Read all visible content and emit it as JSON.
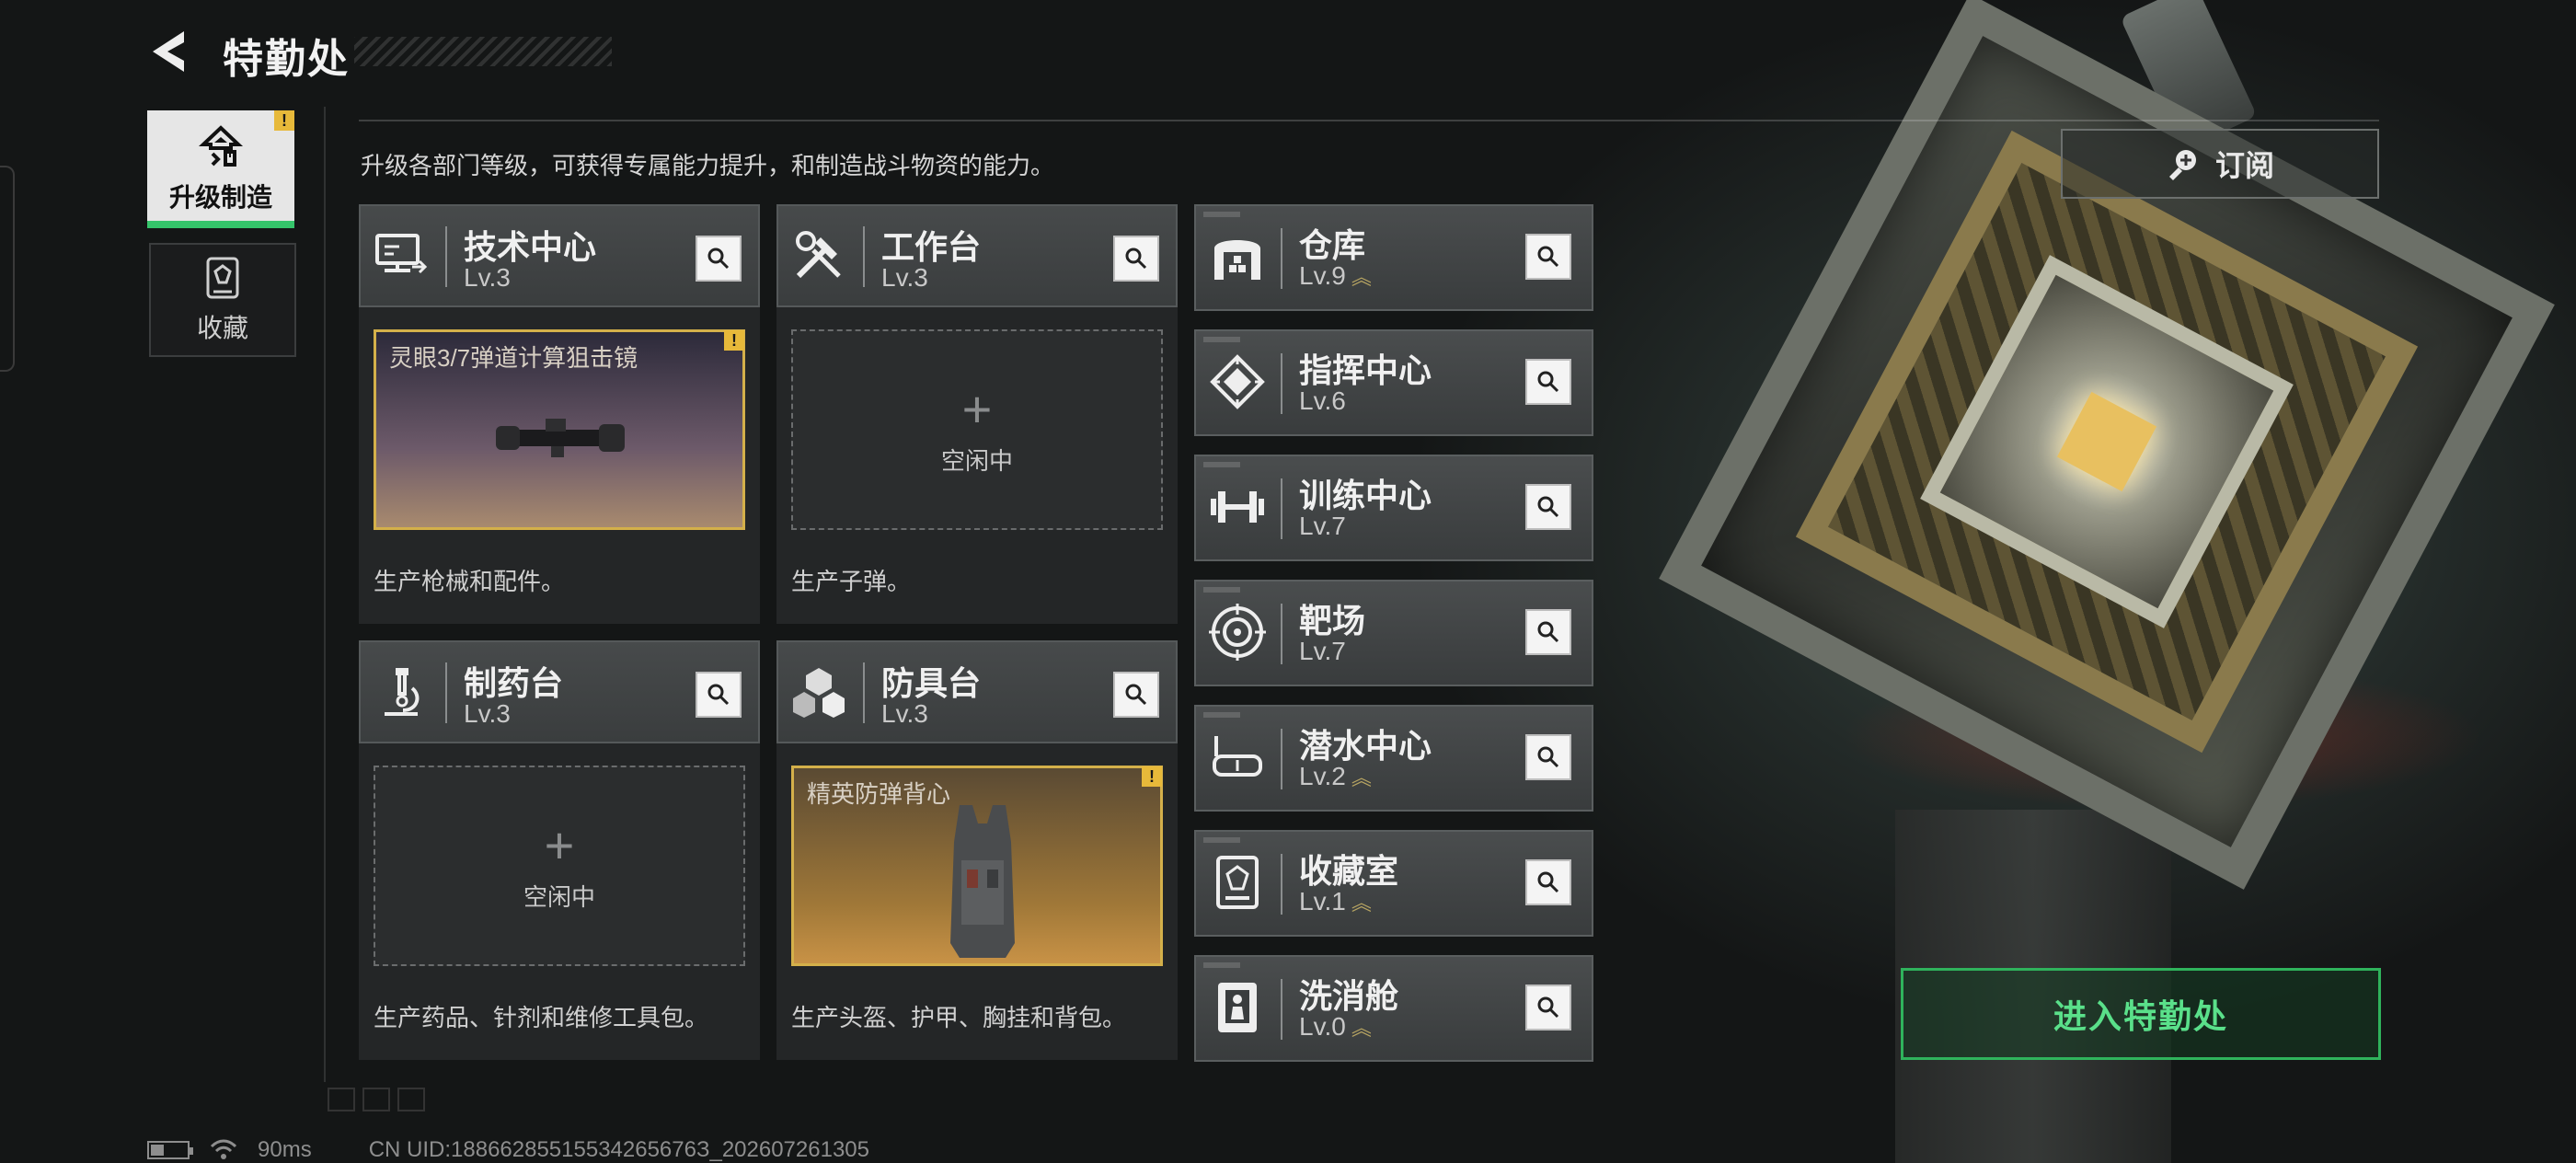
{
  "header": {
    "title": "特勤处"
  },
  "tabs": [
    {
      "label": "升级制造",
      "active": true,
      "alert": "!"
    },
    {
      "label": "收藏",
      "active": false
    }
  ],
  "subtitle": "升级各部门等级，可获得专属能力提升，和制造战斗物资的能力。",
  "big_cards": [
    {
      "name": "技术中心",
      "level": "Lv.3",
      "icon": "monitor-icon",
      "slot": {
        "state": "filled",
        "item": "灵眼3/7弹道计算狙击镜",
        "alert": "!"
      },
      "desc": "生产枪械和配件。"
    },
    {
      "name": "工作台",
      "level": "Lv.3",
      "icon": "tools-icon",
      "slot": {
        "state": "empty",
        "text": "空闲中"
      },
      "desc": "生产子弹。"
    },
    {
      "name": "制药台",
      "level": "Lv.3",
      "icon": "microscope-icon",
      "slot": {
        "state": "empty",
        "text": "空闲中"
      },
      "desc": "生产药品、针剂和维修工具包。"
    },
    {
      "name": "防具台",
      "level": "Lv.3",
      "icon": "cubes-icon",
      "slot": {
        "state": "filled",
        "item": "精英防弹背心",
        "alert": "!"
      },
      "desc": "生产头盔、护甲、胸挂和背包。"
    }
  ],
  "mini_cards": [
    {
      "name": "仓库",
      "level": "Lv.9",
      "upgradable": true,
      "icon": "warehouse-icon"
    },
    {
      "name": "指挥中心",
      "level": "Lv.6",
      "upgradable": false,
      "icon": "command-icon"
    },
    {
      "name": "训练中心",
      "level": "Lv.7",
      "upgradable": false,
      "icon": "dumbbell-icon"
    },
    {
      "name": "靶场",
      "level": "Lv.7",
      "upgradable": false,
      "icon": "target-icon"
    },
    {
      "name": "潜水中心",
      "level": "Lv.2",
      "upgradable": true,
      "icon": "diving-mask-icon"
    },
    {
      "name": "收藏室",
      "level": "Lv.1",
      "upgradable": true,
      "icon": "collection-icon"
    },
    {
      "name": "洗消舱",
      "level": "Lv.0",
      "upgradable": true,
      "icon": "decon-icon"
    }
  ],
  "subscribe_label": "订阅",
  "enter_label": "进入特勤处",
  "footer": {
    "ping": "90ms",
    "uid": "CN UID:18866285515534265676З_202607261305"
  },
  "colors": {
    "accent_green": "#35c46a",
    "alert_yellow": "#e7b93a",
    "slot_gold": "#d4b04a"
  }
}
